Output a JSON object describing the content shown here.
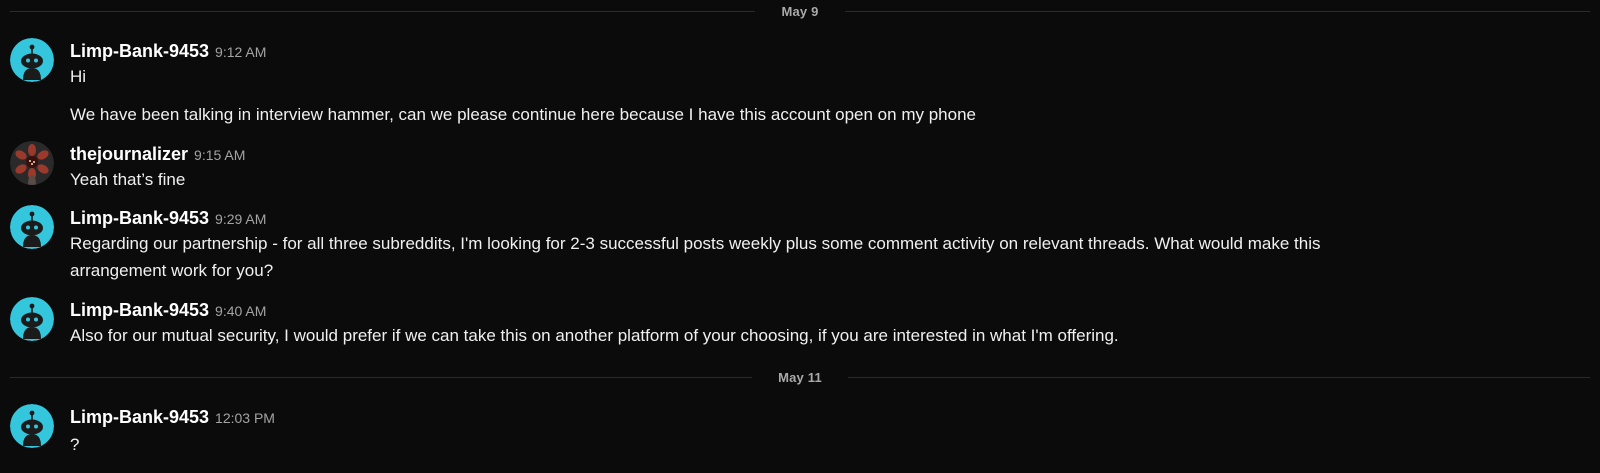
{
  "dates": [
    "May 9",
    "May 11"
  ],
  "messages": [
    {
      "author": "Limp-Bank-9453",
      "time": "9:12 AM",
      "avatar": "snoo-avatar-cyan",
      "lines": [
        "Hi",
        "We have been talking in interview hammer, can we please continue here because I have this account open on my phone"
      ]
    },
    {
      "author": "thejournalizer",
      "time": "9:15 AM",
      "avatar": "flower-monster-avatar",
      "lines": [
        "Yeah that’s fine"
      ]
    },
    {
      "author": "Limp-Bank-9453",
      "time": "9:29 AM",
      "avatar": "snoo-avatar-cyan",
      "lines": [
        "Regarding our partnership - for all three subreddits, I'm looking for 2-3 successful posts weekly plus some comment activity on relevant threads. What would make this",
        "arrangement work for you?"
      ]
    },
    {
      "author": "Limp-Bank-9453",
      "time": "9:40 AM",
      "avatar": "snoo-avatar-cyan",
      "lines": [
        "Also for our mutual security, I would prefer if we can take this on another platform of your choosing, if you are interested in what I'm offering."
      ]
    },
    {
      "author": "Limp-Bank-9453",
      "time": "12:03 PM",
      "avatar": "snoo-avatar-cyan",
      "lines": [
        "?"
      ]
    }
  ],
  "colors": {
    "background": "#0b0b0b",
    "divider": "#2b2b2b",
    "snoo_avatar": "#34c6dc"
  }
}
